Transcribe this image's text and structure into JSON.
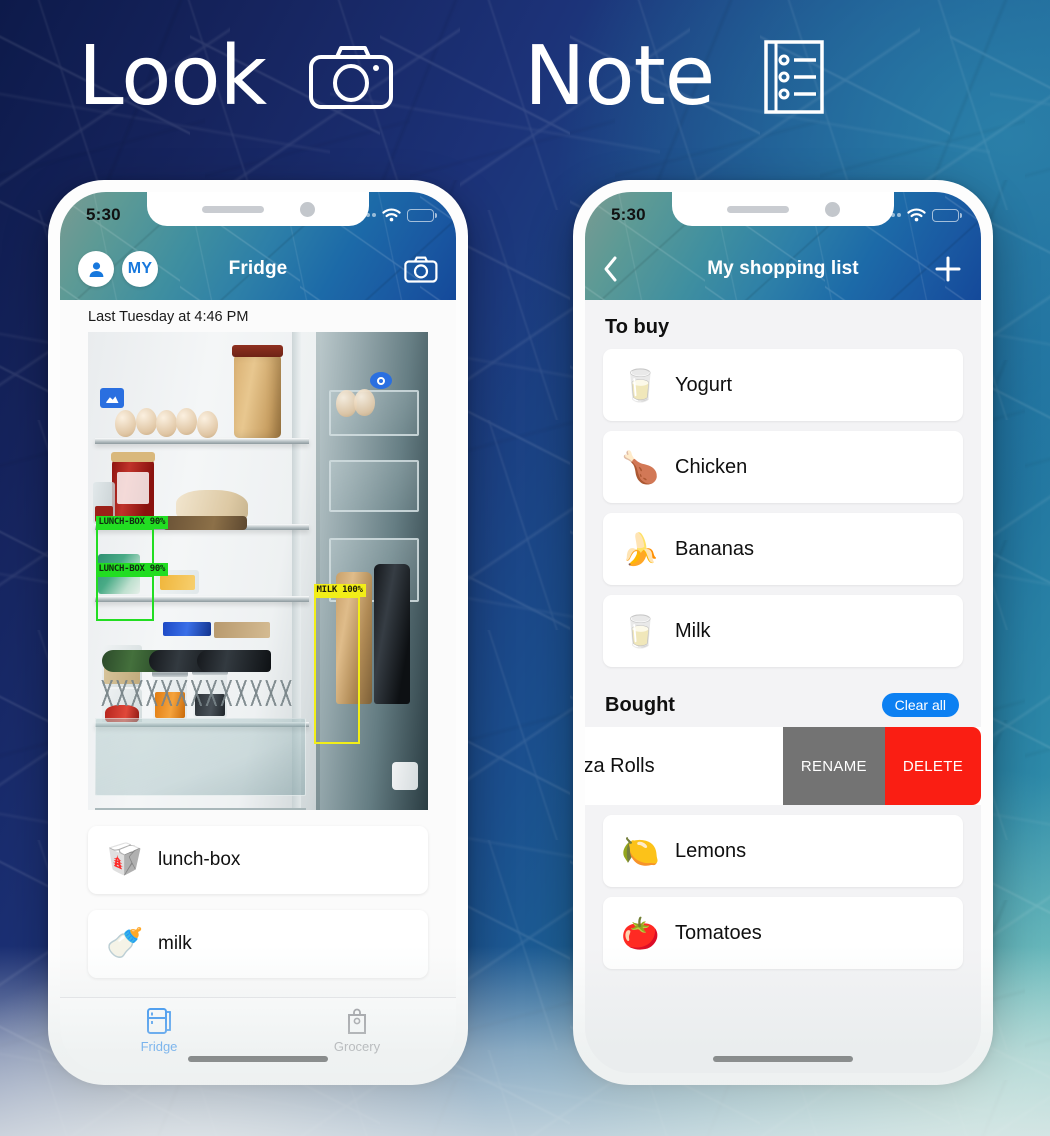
{
  "headline": {
    "left_word": "Look",
    "left_icon": "camera-icon",
    "right_word": "Note",
    "right_icon": "list-icon"
  },
  "colors": {
    "accent_blue": "#0c80f2",
    "tab_active": "#0a7cf2",
    "tab_inactive": "#8b8b90",
    "delete_red": "#fa1e13",
    "rename_gray": "#737373",
    "detect_green": "#22dd22",
    "detect_yellow": "#f2ee18",
    "bg_gradient_from": "#0d1a4a",
    "bg_gradient_to": "#57a9ae"
  },
  "phone_left": {
    "status": {
      "time": "5:30",
      "wifi_icon": "wifi-icon",
      "battery_icon": "battery-low-icon"
    },
    "navbar": {
      "avatar_icon": "person-icon",
      "avatar_initials": "MY",
      "title": "Fridge",
      "camera_icon": "camera-icon"
    },
    "timestamp": "Last Tuesday at 4:46 PM",
    "detections": [
      {
        "label": "LUNCH-BOX",
        "confidence": "90%",
        "color": "green"
      },
      {
        "label": "LUNCH-BOX",
        "confidence": "90%",
        "color": "green"
      },
      {
        "label": "MILK",
        "confidence": "100%",
        "color": "yellow"
      }
    ],
    "detected_items": [
      {
        "emoji": "🥡",
        "label": "lunch-box",
        "icon": "lunch-box-icon"
      },
      {
        "emoji": "🍼",
        "label": "milk",
        "icon": "milk-bottle-icon"
      }
    ],
    "tabs": [
      {
        "label": "Fridge",
        "icon": "fridge-icon",
        "active": true
      },
      {
        "label": "Grocery",
        "icon": "grocery-bag-icon",
        "active": false
      }
    ]
  },
  "phone_right": {
    "status": {
      "time": "5:30",
      "wifi_icon": "wifi-icon",
      "battery_icon": "battery-low-icon"
    },
    "navbar": {
      "back_icon": "chevron-left-icon",
      "title": "My shopping list",
      "add_icon": "plus-icon"
    },
    "sections": [
      {
        "title": "To buy",
        "items": [
          {
            "emoji": "🥛",
            "label": "Yogurt",
            "icon": "yogurt-icon"
          },
          {
            "emoji": "🍗",
            "label": "Chicken",
            "icon": "chicken-icon"
          },
          {
            "emoji": "🍌",
            "label": "Bananas",
            "icon": "banana-icon"
          },
          {
            "emoji": "🥛",
            "label": "Milk",
            "icon": "milk-carton-icon"
          }
        ]
      },
      {
        "title": "Bought",
        "action_label": "Clear all",
        "swiped_item": {
          "label": "izza Rolls",
          "rename_label": "RENAME",
          "delete_label": "DELETE"
        },
        "items": [
          {
            "emoji": "🍋",
            "label": "Lemons",
            "icon": "lemon-icon"
          },
          {
            "emoji": "🍅",
            "label": "Tomatoes",
            "icon": "tomato-icon"
          }
        ]
      }
    ]
  }
}
